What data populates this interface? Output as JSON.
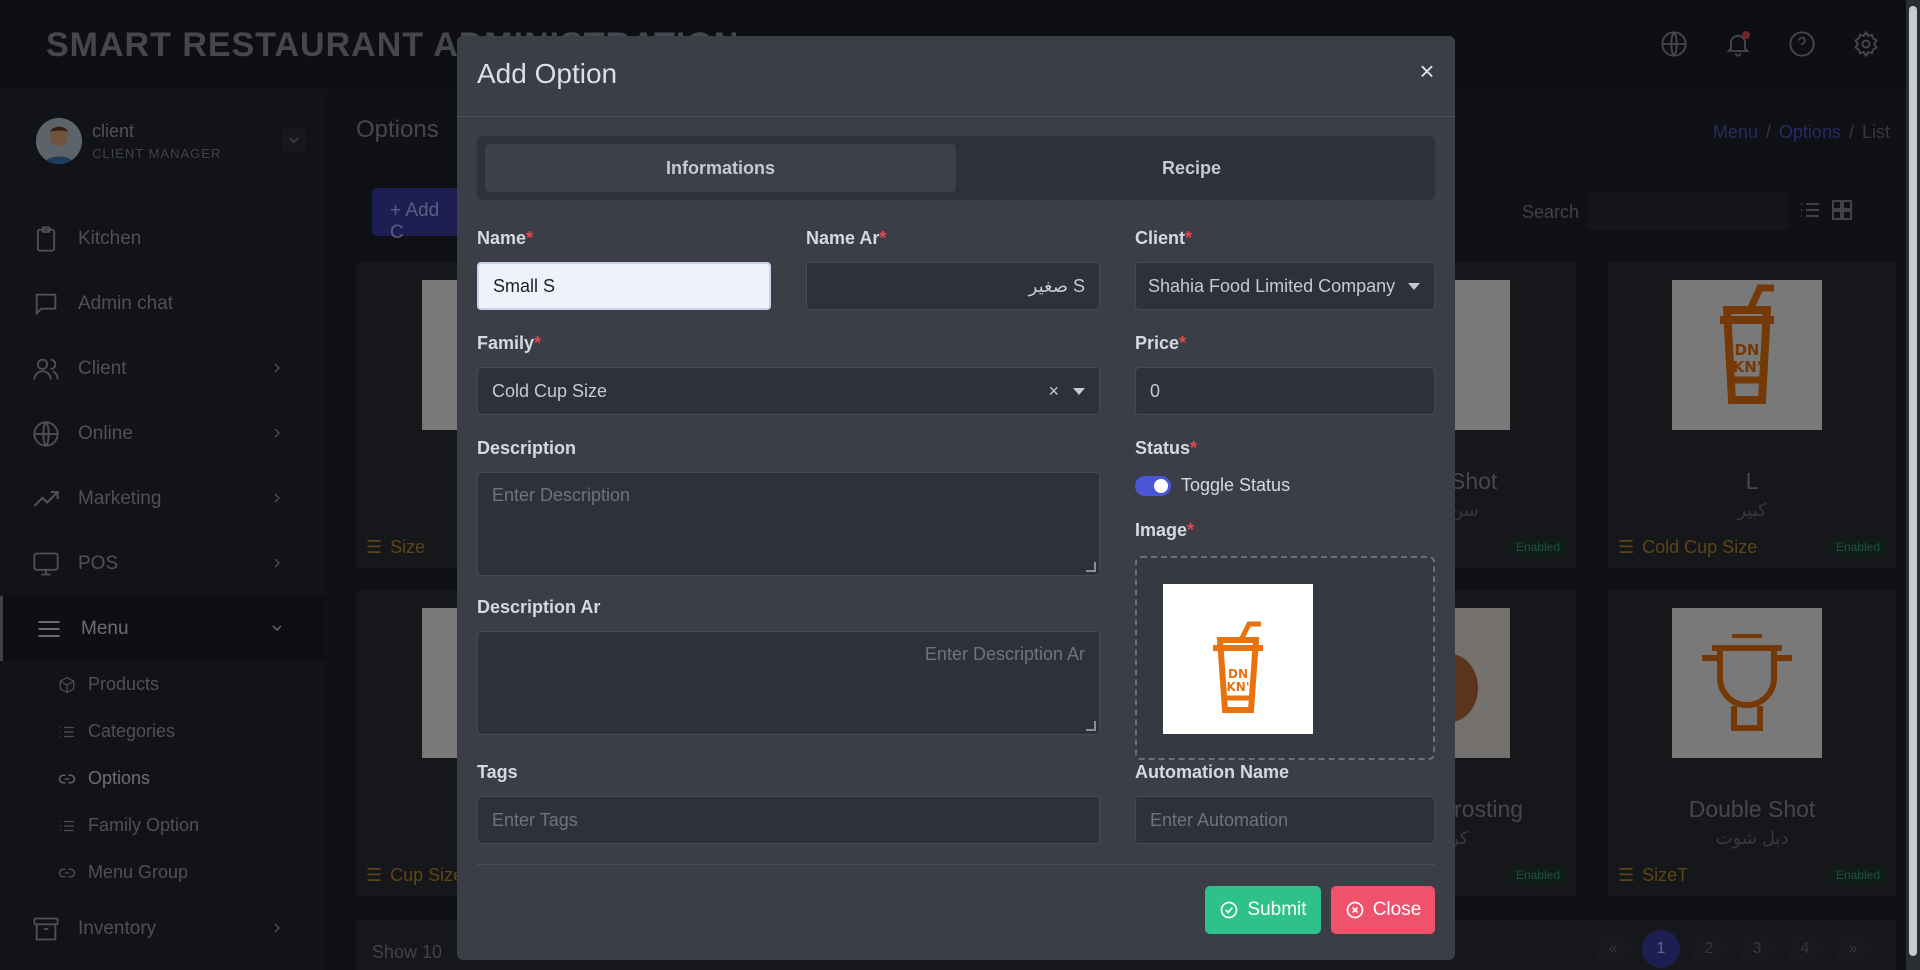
{
  "app": {
    "title": "SMART RESTAURANT ADMINISTRATION"
  },
  "user": {
    "name": "client",
    "role": "CLIENT MANAGER"
  },
  "sidebar": {
    "items": [
      {
        "label": "Kitchen",
        "icon": "clipboard-icon"
      },
      {
        "label": "Admin chat",
        "icon": "chat-icon"
      },
      {
        "label": "Client",
        "icon": "users-icon"
      },
      {
        "label": "Online",
        "icon": "globe-icon"
      },
      {
        "label": "Marketing",
        "icon": "trend-icon"
      },
      {
        "label": "POS",
        "icon": "monitor-icon"
      },
      {
        "label": "Menu",
        "icon": "menu-icon"
      },
      {
        "label": "Inventory",
        "icon": "archive-icon"
      }
    ],
    "menu_sub": [
      {
        "label": "Products",
        "icon": "box-icon"
      },
      {
        "label": "Categories",
        "icon": "list-icon"
      },
      {
        "label": "Options",
        "icon": "link-icon"
      },
      {
        "label": "Family Option",
        "icon": "list-icon"
      },
      {
        "label": "Menu Group",
        "icon": "link-icon"
      }
    ]
  },
  "page": {
    "title": "Options",
    "breadcrumb": [
      "Menu",
      "Options",
      "List"
    ],
    "add_label": "+ Add C",
    "search_label": "Search",
    "show_label": "Show",
    "show_value": "10",
    "pagination": [
      "«",
      "1",
      "2",
      "3",
      "4",
      "»"
    ]
  },
  "cards": [
    {
      "name": "",
      "name_ar": "",
      "family": "Size",
      "status": ""
    },
    {
      "name": "Shot",
      "name_ar": "سن",
      "family": "",
      "status": "Enabled"
    },
    {
      "name": "L",
      "name_ar": "كبير",
      "family": "Cold Cup Size",
      "status": "Enabled"
    },
    {
      "name": "",
      "name_ar": "",
      "family": "Cup Size",
      "status": ""
    },
    {
      "name": "Frosting",
      "name_ar": "كر",
      "family": "",
      "status": "Enabled"
    },
    {
      "name": "Double Shot",
      "name_ar": "دبل شوت",
      "family": "SizeT",
      "status": "Enabled"
    }
  ],
  "modal": {
    "title": "Add Option",
    "close_glyph": "×",
    "tabs": [
      "Informations",
      "Recipe"
    ],
    "fields": {
      "name": {
        "label": "Name",
        "value": "Small S"
      },
      "name_ar": {
        "label": "Name Ar",
        "value": "صغير S"
      },
      "client": {
        "label": "Client",
        "value": "Shahia Food Limited Company"
      },
      "family": {
        "label": "Family",
        "value": "Cold Cup Size",
        "clear": "×"
      },
      "price": {
        "label": "Price",
        "value": "0"
      },
      "description": {
        "label": "Description",
        "placeholder": "Enter Description"
      },
      "status": {
        "label": "Status",
        "toggle_label": "Toggle Status",
        "on": true
      },
      "description_ar": {
        "label": "Description Ar",
        "placeholder": "Enter Description Ar"
      },
      "image": {
        "label": "Image"
      },
      "tags": {
        "label": "Tags",
        "placeholder": "Enter Tags"
      },
      "automation": {
        "label": "Automation Name",
        "placeholder": "Enter Automation"
      }
    },
    "required_mark": "*",
    "submit_label": "Submit",
    "close_label": "Close"
  },
  "colors": {
    "accent": "#4b56d6",
    "submit": "#2fc18a",
    "close": "#f0516b",
    "required": "#e5484d",
    "brand_orange": "#e8720c"
  }
}
